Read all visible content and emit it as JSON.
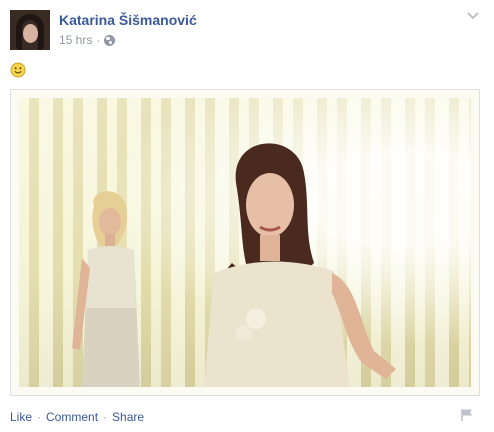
{
  "post": {
    "author_name": "Katarina Šišmanović",
    "timestamp": "15 hrs",
    "separator": "·",
    "audience_icon": "globe-icon",
    "text_emoji": "🙂",
    "image_alt": "Two women in white dresses in a sunlit room"
  },
  "actions": {
    "like_label": "Like",
    "comment_label": "Comment",
    "share_label": "Share",
    "separator": "·"
  },
  "colors": {
    "link_blue": "#3b5998",
    "meta_gray": "#9197a3",
    "border": "#dddfe2"
  }
}
